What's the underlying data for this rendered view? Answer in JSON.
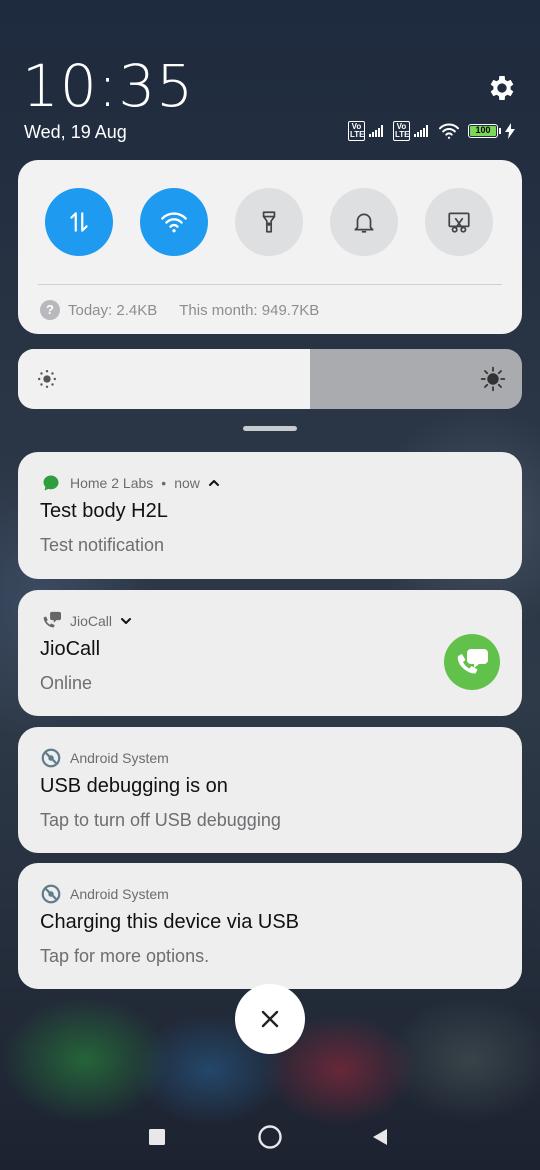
{
  "status": {
    "time": "10:35",
    "date": "Wed, 19 Aug",
    "volte_label": "Vo LTE",
    "battery_level": "100"
  },
  "quick_settings": {
    "tiles": [
      {
        "name": "mobile-data",
        "state": "on"
      },
      {
        "name": "wifi",
        "state": "on"
      },
      {
        "name": "flashlight",
        "state": "off"
      },
      {
        "name": "ring-mode",
        "state": "off"
      },
      {
        "name": "screenshot",
        "state": "off"
      }
    ],
    "data_usage_today": "Today: 2.4KB",
    "data_usage_month": "This month: 949.7KB",
    "usage_help_symbol": "?"
  },
  "brightness": {
    "level": 0.58
  },
  "notifications": [
    {
      "app": "Home 2 Labs",
      "time": "now",
      "separator": "•",
      "title": "Test body H2L",
      "text": "Test notification"
    },
    {
      "app": "JioCall",
      "title": "JioCall",
      "text": "Online"
    },
    {
      "app": "Android System",
      "title": "USB debugging is on",
      "text": "Tap to turn off USB debugging"
    },
    {
      "app": "Android System",
      "title": "Charging this device via USB",
      "text": "Tap for more options."
    }
  ],
  "colors": {
    "accent": "#1e9bf0",
    "panel": "#f2f2f3",
    "jio_green": "#62c14a",
    "h2l_green": "#2e9e3e"
  }
}
